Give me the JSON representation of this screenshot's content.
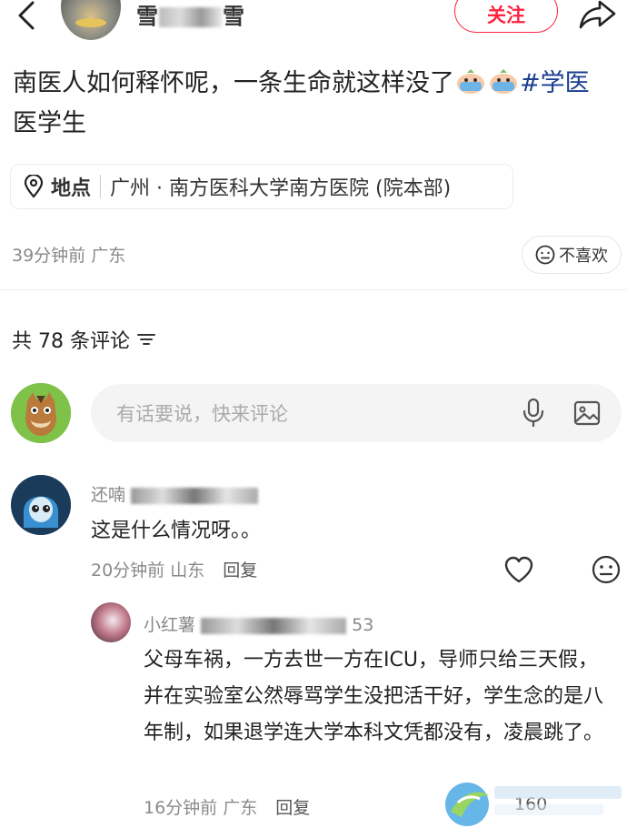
{
  "header": {
    "author_name_visible": "雪",
    "author_name_tail": "雪",
    "follow_label": "关注"
  },
  "post": {
    "text_before_emoji": "南医人如何释怀呢，一条生命就这样没了",
    "tag_part1": "#学医",
    "text_line2": "医学生",
    "location_label": "地点",
    "location_value": "广州 · 南方医科大学南方医院 (院本部)",
    "meta": "39分钟前 广东",
    "dislike_label": "不喜欢"
  },
  "comments_header": {
    "label": "共 78 条评论"
  },
  "comment_input": {
    "placeholder": "有话要说，快来评论"
  },
  "comments": [
    {
      "name_visible": "还喃",
      "text": "这是什么情况呀。。",
      "meta": "20分钟前 山东",
      "reply_label": "回复",
      "replies": [
        {
          "name_visible": "小红薯",
          "name_tail": "53",
          "text": "父母车祸，一方去世一方在ICU，导师只给三天假，并在实验室公然辱骂学生没把活干好，学生念的是八年制，如果退学连大学本科文凭都没有，凌晨跳了。",
          "meta": "16分钟前 广东",
          "reply_label": "回复",
          "like_count": "160"
        }
      ]
    }
  ],
  "colors": {
    "accent": "#ff2442",
    "tag": "#1a3d8f",
    "muted": "#8a8a8a",
    "input_bg": "#f4f4f4"
  },
  "icons": {
    "back": "chevron-left-icon",
    "share": "share-arrow-icon",
    "location": "location-pin-icon",
    "dislike": "neutral-face-icon",
    "sort": "sort-lines-icon",
    "mic": "microphone-icon",
    "image": "image-icon",
    "like": "heart-icon"
  }
}
